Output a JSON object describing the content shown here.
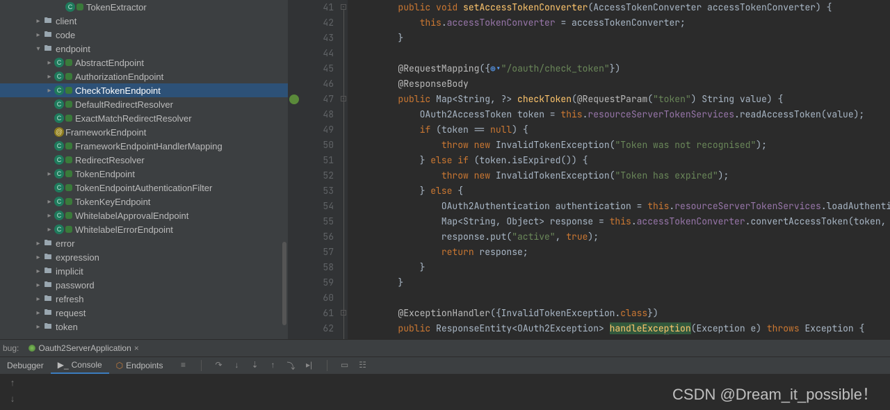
{
  "tree": {
    "items": [
      {
        "indent": 5,
        "arrow": "none",
        "kind": "cls",
        "label": "TokenExtractor"
      },
      {
        "indent": 3,
        "arrow": "right",
        "kind": "folder",
        "label": "client"
      },
      {
        "indent": 3,
        "arrow": "right",
        "kind": "folder",
        "label": "code"
      },
      {
        "indent": 3,
        "arrow": "down",
        "kind": "folder",
        "label": "endpoint"
      },
      {
        "indent": 4,
        "arrow": "right",
        "kind": "cls",
        "label": "AbstractEndpoint"
      },
      {
        "indent": 4,
        "arrow": "right",
        "kind": "cls",
        "label": "AuthorizationEndpoint"
      },
      {
        "indent": 4,
        "arrow": "right",
        "kind": "cls",
        "label": "CheckTokenEndpoint",
        "selected": true
      },
      {
        "indent": 4,
        "arrow": "none",
        "kind": "cls",
        "label": "DefaultRedirectResolver"
      },
      {
        "indent": 4,
        "arrow": "none",
        "kind": "cls",
        "label": "ExactMatchRedirectResolver"
      },
      {
        "indent": 4,
        "arrow": "none",
        "kind": "anno",
        "label": "FrameworkEndpoint"
      },
      {
        "indent": 4,
        "arrow": "none",
        "kind": "cls",
        "label": "FrameworkEndpointHandlerMapping"
      },
      {
        "indent": 4,
        "arrow": "none",
        "kind": "cls",
        "label": "RedirectResolver"
      },
      {
        "indent": 4,
        "arrow": "right",
        "kind": "cls",
        "label": "TokenEndpoint"
      },
      {
        "indent": 4,
        "arrow": "none",
        "kind": "cls",
        "label": "TokenEndpointAuthenticationFilter"
      },
      {
        "indent": 4,
        "arrow": "right",
        "kind": "cls",
        "label": "TokenKeyEndpoint"
      },
      {
        "indent": 4,
        "arrow": "right",
        "kind": "cls",
        "label": "WhitelabelApprovalEndpoint"
      },
      {
        "indent": 4,
        "arrow": "right",
        "kind": "cls",
        "label": "WhitelabelErrorEndpoint"
      },
      {
        "indent": 3,
        "arrow": "right",
        "kind": "folder",
        "label": "error"
      },
      {
        "indent": 3,
        "arrow": "right",
        "kind": "folder",
        "label": "expression"
      },
      {
        "indent": 3,
        "arrow": "right",
        "kind": "folder",
        "label": "implicit"
      },
      {
        "indent": 3,
        "arrow": "right",
        "kind": "folder",
        "label": "password"
      },
      {
        "indent": 3,
        "arrow": "right",
        "kind": "folder",
        "label": "refresh"
      },
      {
        "indent": 3,
        "arrow": "right",
        "kind": "folder",
        "label": "request"
      },
      {
        "indent": 3,
        "arrow": "right",
        "kind": "folder",
        "label": "token"
      }
    ]
  },
  "editor": {
    "first_line": 41,
    "lines": [
      {
        "n": 41,
        "html": "        <span class='kw'>public</span> <span class='kw'>void</span> <span class='fn'>setAccessTokenConverter</span>(AccessTokenConverter accessTokenConverter) {"
      },
      {
        "n": 42,
        "html": "            <span class='kw'>this</span>.<span class='field'>accessTokenConverter</span> = accessTokenConverter;"
      },
      {
        "n": 43,
        "html": "        }"
      },
      {
        "n": 44,
        "html": ""
      },
      {
        "n": 45,
        "html": "        <span class='ann'>@RequestMapping</span>({<span class='wlink'>⊕▾</span><span class='str'>\"/oauth/check_token\"</span>})"
      },
      {
        "n": 46,
        "html": "        <span class='ann'>@ResponseBody</span>"
      },
      {
        "n": 47,
        "html": "        <span class='kw'>public</span> Map&lt;String, ?&gt; <span class='fn'>checkToken</span>(<span class='ann'>@RequestParam</span>(<span class='str'>\"token\"</span>) String value) {",
        "marker": true
      },
      {
        "n": 48,
        "html": "            OAuth2AccessToken token = <span class='kw'>this</span>.<span class='field'>resourceServerTokenServices</span>.readAccessToken(value);"
      },
      {
        "n": 49,
        "html": "            <span class='kw'>if</span> (token == <span class='kw'>null</span>) {"
      },
      {
        "n": 50,
        "html": "                <span class='kw'>throw</span> <span class='kw'>new</span> InvalidTokenException(<span class='str'>\"Token was not recognised\"</span>);"
      },
      {
        "n": 51,
        "html": "            } <span class='kw'>else</span> <span class='kw'>if</span> (token.isExpired()) {"
      },
      {
        "n": 52,
        "html": "                <span class='kw'>throw</span> <span class='kw'>new</span> InvalidTokenException(<span class='str'>\"Token has expired\"</span>);"
      },
      {
        "n": 53,
        "html": "            } <span class='kw'>else</span> {"
      },
      {
        "n": 54,
        "html": "                OAuth2Authentication authentication = <span class='kw'>this</span>.<span class='field'>resourceServerTokenServices</span>.loadAuthenticatio"
      },
      {
        "n": 55,
        "html": "                Map&lt;String, Object&gt; response = <span class='kw'>this</span>.<span class='field'>accessTokenConverter</span>.convertAccessToken(token, authe"
      },
      {
        "n": 56,
        "html": "                response.put(<span class='str'>\"active\"</span>, <span class='kw'>true</span>);"
      },
      {
        "n": 57,
        "html": "                <span class='kw'>return</span> response;"
      },
      {
        "n": 58,
        "html": "            }"
      },
      {
        "n": 59,
        "html": "        }"
      },
      {
        "n": 60,
        "html": ""
      },
      {
        "n": 61,
        "html": "        <span class='ann'>@ExceptionHandler</span>({InvalidTokenException.<span class='kw'>class</span>})"
      },
      {
        "n": 62,
        "html": "        <span class='kw'>public</span> ResponseEntity&lt;OAuth2Exception&gt; <span class='hl-method'>handleExce<span class='caret-word'>p</span>tion</span>(Exception e) <span class='kw'>throws</span> Exception {"
      }
    ]
  },
  "run": {
    "prefix": "bug:",
    "tab_label": "Oauth2ServerApplication"
  },
  "tool_tabs": {
    "debugger": "Debugger",
    "console": "Console",
    "endpoints": "Endpoints"
  },
  "watermark": "CSDN @Dream_it_possible！"
}
